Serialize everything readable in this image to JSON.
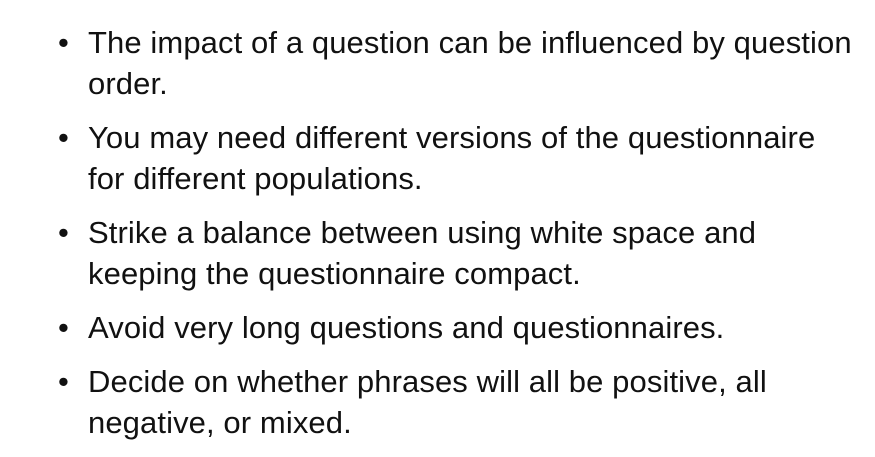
{
  "slide": {
    "bullet_glyph": "•",
    "bullets": [
      {
        "text": "The impact of a question can be influenced by question order."
      },
      {
        "text": "You may need different versions of the questionnaire for different populations."
      },
      {
        "text": "Strike a balance between using white space and keeping the questionnaire compact."
      },
      {
        "text": "Avoid very long questions and questionnaires."
      },
      {
        "text": "Decide on whether phrases will all be positive, all negative, or mixed."
      }
    ]
  }
}
